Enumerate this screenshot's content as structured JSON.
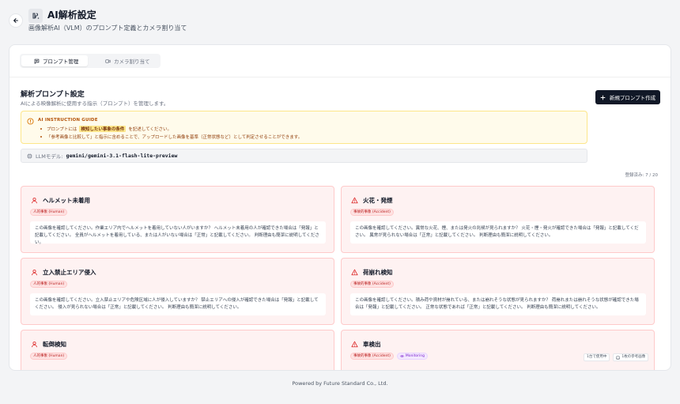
{
  "header": {
    "title": "AI解析設定",
    "subtitle": "画像解析AI（VLM）のプロンプト定義とカメラ割り当て"
  },
  "tabs": [
    {
      "label": "プロンプト管理",
      "active": true,
      "icon": "message-icon"
    },
    {
      "label": "カメラ割り当て",
      "active": false,
      "icon": "video-icon"
    }
  ],
  "section": {
    "title": "解析プロンプト設定",
    "description": "AIによる映像解析に使用する指示（プロンプト）を管理します。",
    "new_button": "新規プロンプト作成"
  },
  "guide": {
    "title": "AI INSTRUCTION GUIDE",
    "line1_pre": "プロンプトには",
    "line1_highlight": "検知したい事象の条件",
    "line1_post": "を記述してください。",
    "line2": "「参考画像と比較して」と指示に含めることで、アップロードした画像を基準（正常状態など）として判定させることができます。"
  },
  "llm": {
    "label": "LLMモデル:",
    "value": "gemini/gemini-3.1-flash-lite-preview"
  },
  "count": "登録済み: 7 / 20",
  "prompts": [
    {
      "title": "ヘルメット未着用",
      "icon": "user-icon",
      "badge": "人的事象 (Human)",
      "body": "この画像を確認してください。作業エリア内でヘルメットを着用していない人がいますか？ ヘルメット未着用の人が確認できた場合は「発報」と記載してください。 全員がヘルメットを着用している、または人がいない場合は「正常」と記載してください。 判断理由も簡潔に説明してください。"
    },
    {
      "title": "火花・発煙",
      "icon": "warning-icon",
      "badge": "事故的事象 (Accident)",
      "body": "この画像を確認してください。異常な火花、煙、または発火の兆候が見られますか？ 火花・煙・発火が確認できた場合は「発報」と記載してください。 異常が見られない場合は「正常」と記載してください。 判断理由も簡潔に説明してください。"
    },
    {
      "title": "立入禁止エリア侵入",
      "icon": "user-icon",
      "badge": "人的事象 (Human)",
      "body": "この画像を確認してください。立入禁止エリアや危険区域に人が侵入していますか？ 禁止エリアへの侵入が確認できた場合は「発報」と記載してください。 侵入が見られない場合は「正常」と記載してください。 判断理由も簡潔に説明してください。"
    },
    {
      "title": "荷崩れ検知",
      "icon": "warning-icon",
      "badge": "事故的事象 (Accident)",
      "body": "この画像を確認してください。積み荷や資材が崩れている、または崩れそうな状態が見られますか？ 荷崩れまたは崩れそうな状態が確認できた場合は「発報」と記載してください。 正常な状態であれば「正常」と記載してください。 判断理由も簡潔に説明してください。"
    },
    {
      "title": "転倒検知",
      "icon": "user-icon",
      "badge": "人的事象 (Human)",
      "body": ""
    },
    {
      "title": "車検出",
      "icon": "warning-icon",
      "badge": "事故的事象 (Accident)",
      "badge2": "Monitoring",
      "meta1": "1台で使用中",
      "meta2": "1枚の参考画像",
      "body": ""
    }
  ],
  "footer": "Powered by Future Standard Co., Ltd."
}
